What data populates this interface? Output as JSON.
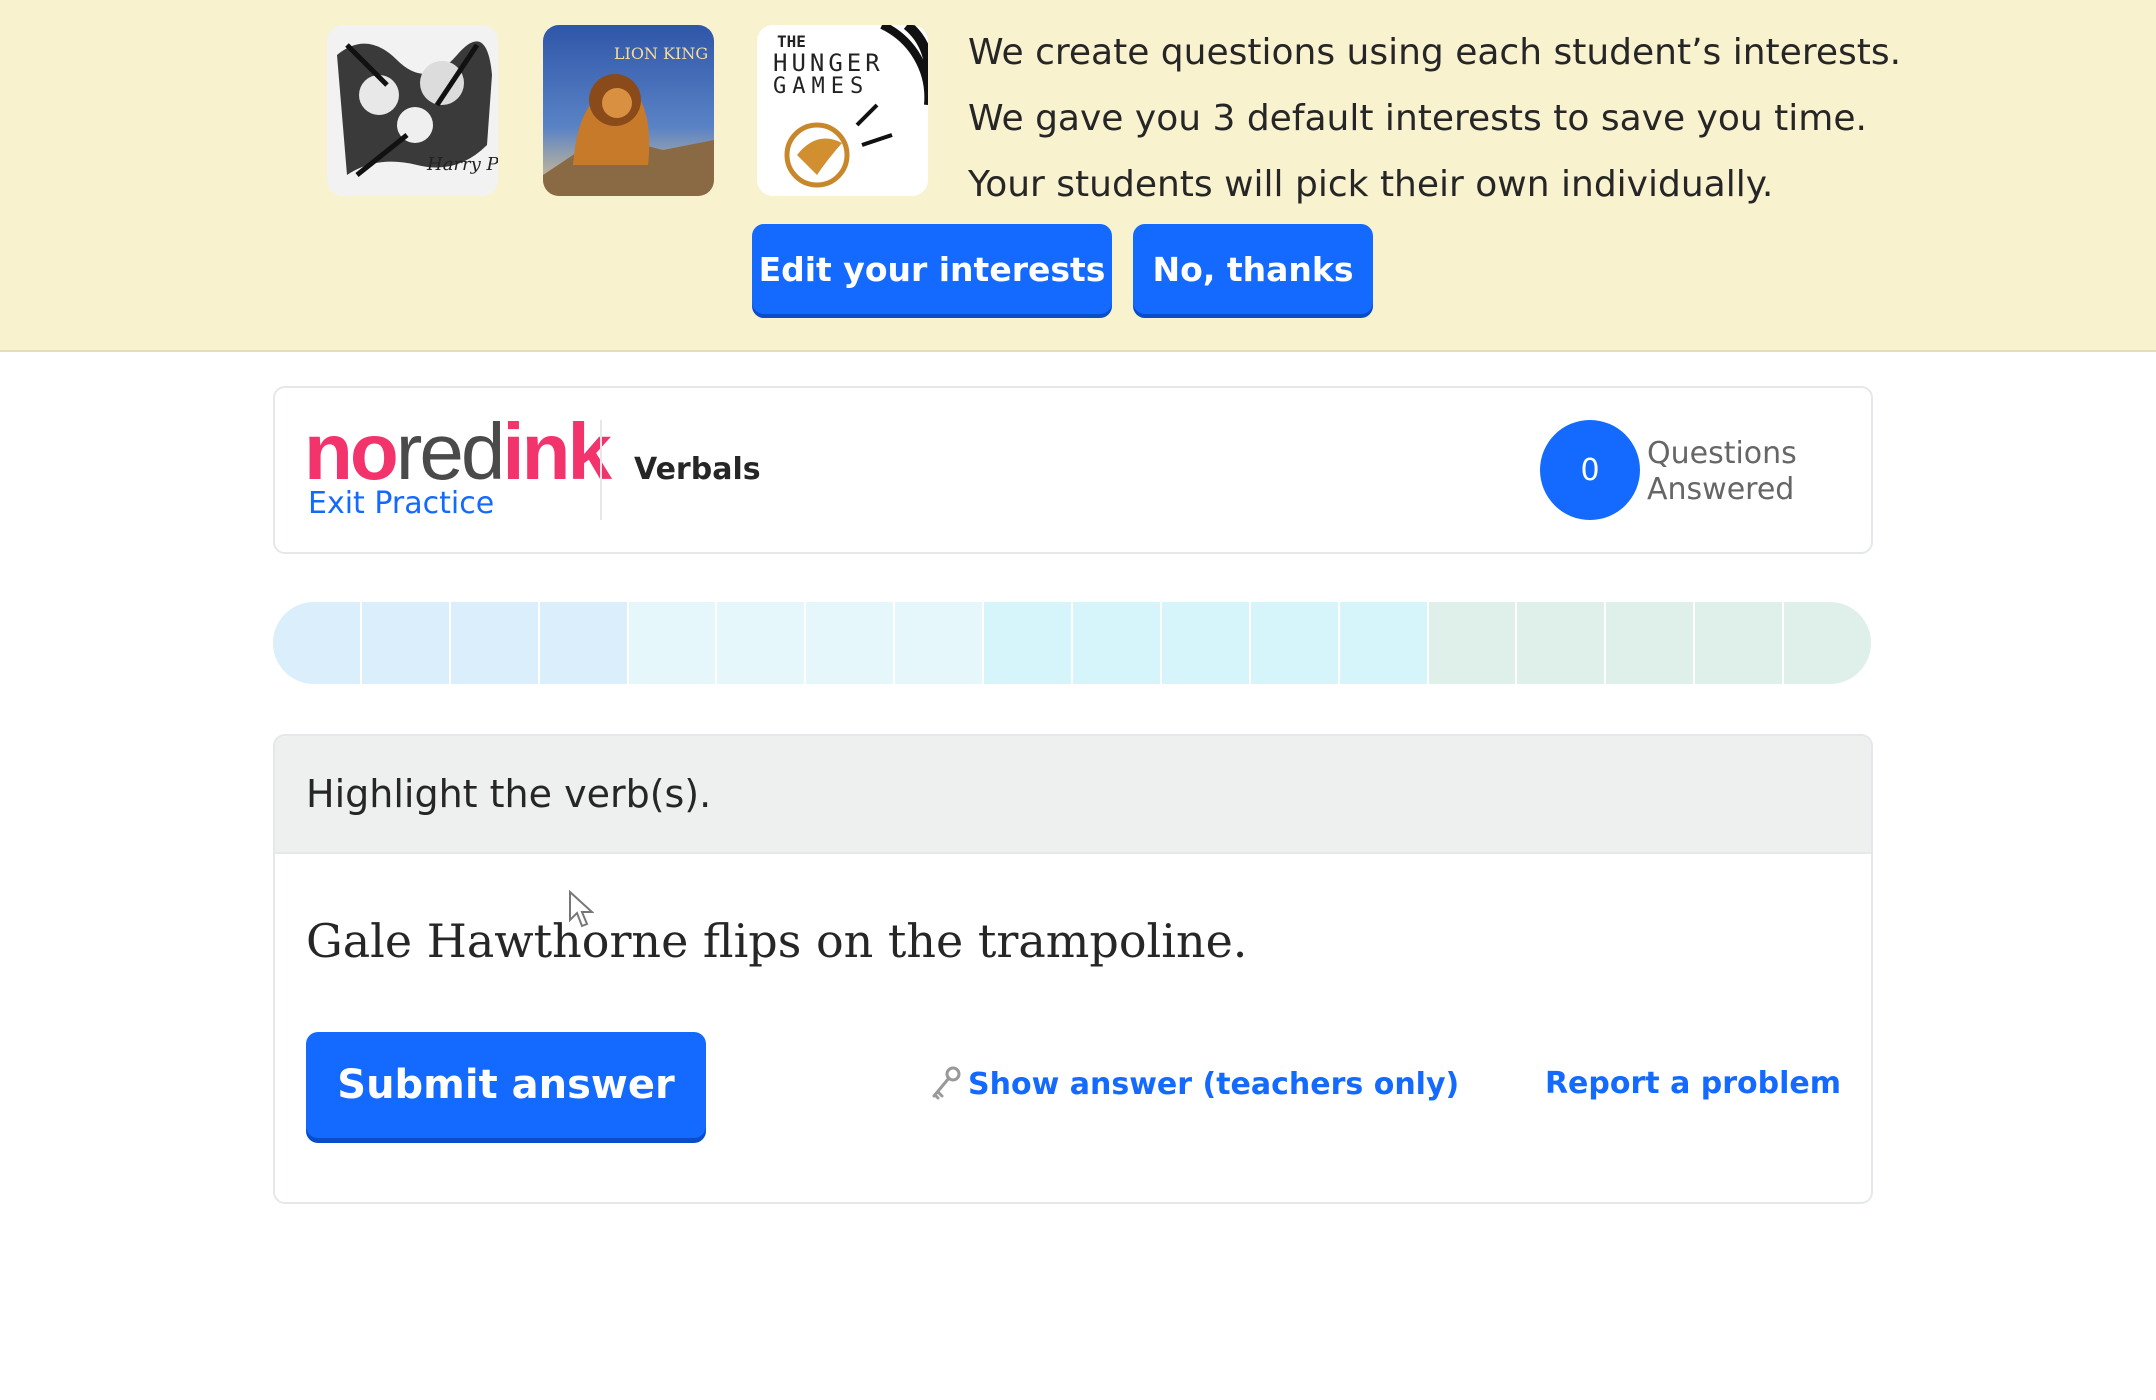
{
  "banner": {
    "lines": [
      "We create questions using each student’s interests.",
      "We gave you 3 default interests to save you time.",
      "Your students will pick their own individually."
    ],
    "edit_button": "Edit your interests",
    "decline_button": "No, thanks",
    "thumbnails": [
      {
        "icon": "harry-potter-poster",
        "label": "Harry Potter"
      },
      {
        "icon": "lion-king-poster",
        "label": "LION KING"
      },
      {
        "icon": "hunger-games-poster",
        "label_top": "THE",
        "label_mid": "HUNGER",
        "label_bottom": "GAMES"
      }
    ]
  },
  "header": {
    "logo": {
      "part1": "no",
      "part2": "red",
      "part3": "ink"
    },
    "exit_link": "Exit Practice",
    "topic": "Verbals",
    "questions_answered": "0",
    "questions_label_line1": "Questions",
    "questions_label_line2": "Answered"
  },
  "progress": {
    "segments": 18,
    "colors": {
      "done": "#dbeefb",
      "current": "#e6f7fb",
      "upcoming": "#d6f5fb",
      "mastery": "#dff0ea"
    }
  },
  "question": {
    "prompt": "Highlight the verb(s).",
    "sentence": "Gale Hawthorne flips on the trampoline.",
    "submit_button": "Submit answer",
    "show_answer_link": "Show answer (teachers only)",
    "report_link": "Report a problem"
  },
  "colors": {
    "brand_pink": "#f3336c",
    "primary_blue": "#146aff",
    "banner_bg": "#f8f2cf"
  }
}
